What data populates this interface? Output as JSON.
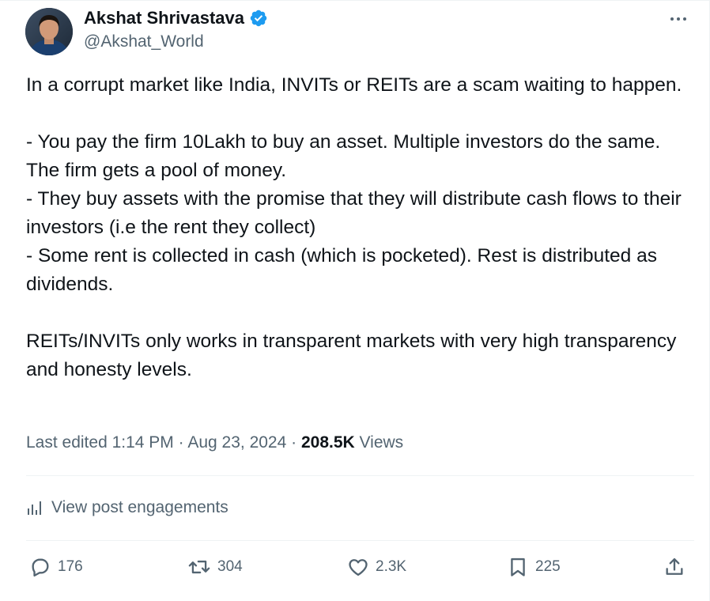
{
  "author": {
    "display_name": "Akshat Shrivastava",
    "handle": "@Akshat_World",
    "verified": true
  },
  "tweet": {
    "lines": [
      "In a corrupt market like India, INVITs or REITs are a scam waiting to happen.",
      "",
      "- You pay the firm 10Lakh to buy an asset. Multiple investors do the same. The firm gets a pool of money.",
      "- They buy assets with the promise that they will distribute cash flows to their investors (i.e the rent they collect)",
      "- Some rent is collected in cash (which is pocketed). Rest is distributed as dividends.",
      "",
      "REITs/INVITs only works in transparent markets with very high transparency and honesty levels."
    ]
  },
  "meta": {
    "edited_prefix": "Last edited",
    "time": "1:14 PM",
    "separator": "·",
    "date": "Aug 23, 2024",
    "views_count": "208.5K",
    "views_label": "Views"
  },
  "engagements": {
    "label": "View post engagements"
  },
  "actions": {
    "replies": "176",
    "reposts": "304",
    "likes": "2.3K",
    "bookmarks": "225"
  },
  "colors": {
    "text": "#0f1419",
    "muted": "#536471",
    "verified": "#1d9bf0",
    "divider": "#eff3f4"
  },
  "icons": [
    "verified-badge-icon",
    "more-icon",
    "engagements-chart-icon",
    "reply-icon",
    "repost-icon",
    "like-icon",
    "bookmark-icon",
    "share-icon"
  ]
}
